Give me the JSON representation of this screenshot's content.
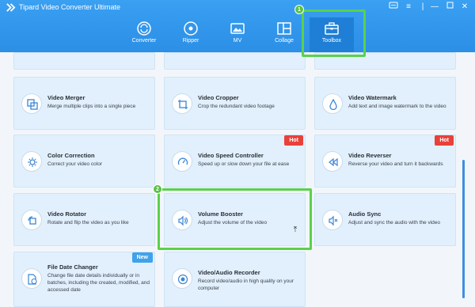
{
  "app": {
    "title": "Tipard Video Converter Ultimate"
  },
  "nav": [
    {
      "label": "Converter",
      "icon": "converter-icon"
    },
    {
      "label": "Ripper",
      "icon": "ripper-icon"
    },
    {
      "label": "MV",
      "icon": "mv-icon"
    },
    {
      "label": "Collage",
      "icon": "collage-icon"
    },
    {
      "label": "Toolbox",
      "icon": "toolbox-icon",
      "active": true
    }
  ],
  "tools": {
    "video_merger": {
      "title": "Video Merger",
      "desc": "Merge multiple clips into a single piece"
    },
    "video_cropper": {
      "title": "Video Cropper",
      "desc": "Crop the redundant video footage"
    },
    "video_watermark": {
      "title": "Video Watermark",
      "desc": "Add text and image watermark to the video"
    },
    "color_correction": {
      "title": "Color Correction",
      "desc": "Correct your video color"
    },
    "video_speed_controller": {
      "title": "Video Speed Controller",
      "desc": "Speed up or slow down your file at ease",
      "badge": "Hot"
    },
    "video_reverser": {
      "title": "Video Reverser",
      "desc": "Reverse your video and turn it backwards",
      "badge": "Hot"
    },
    "video_rotator": {
      "title": "Video Rotator",
      "desc": "Rotate and flip the video as you like"
    },
    "volume_booster": {
      "title": "Volume Booster",
      "desc": "Adjust the volume of the video"
    },
    "audio_sync": {
      "title": "Audio Sync",
      "desc": "Adjust and sync the audio with the video"
    },
    "file_date_changer": {
      "title": "File Date Changer",
      "desc": "Change file date details individually or in batches, including the created, modified, and accessed date",
      "badge": "New"
    },
    "video_audio_recorder": {
      "title": "Video/Audio Recorder",
      "desc": "Record video/audio in high quality on your computer"
    }
  },
  "annotations": {
    "step1": "1",
    "step2": "2"
  },
  "colors": {
    "header": "#2b8fe6",
    "card": "#e1f0fc",
    "highlight": "#5ad14b",
    "hot": "#e8413a",
    "new": "#3fa2ea"
  }
}
